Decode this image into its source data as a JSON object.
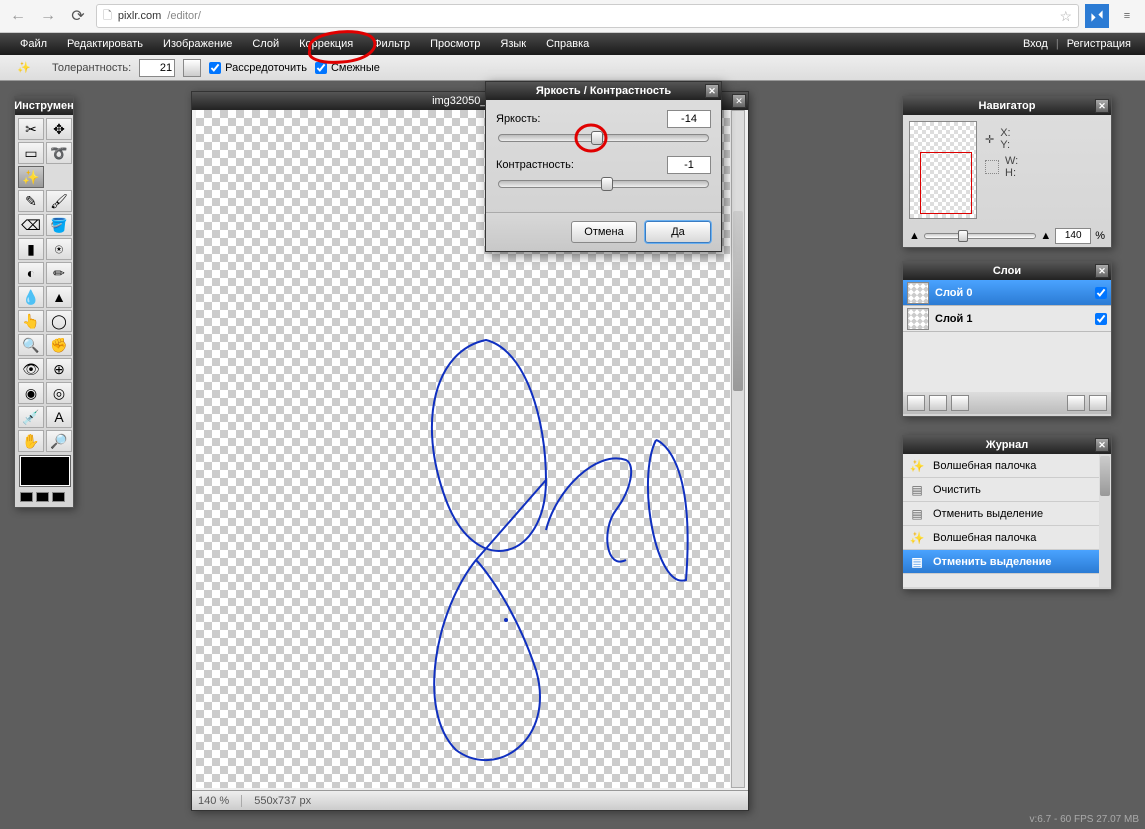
{
  "browser": {
    "url_host": "pixlr.com",
    "url_path": "/editor/"
  },
  "menubar": {
    "items": [
      "Файл",
      "Редактировать",
      "Изображение",
      "Слой",
      "Коррекция",
      "Фильтр",
      "Просмотр",
      "Язык",
      "Справка"
    ],
    "login": "Вход",
    "register": "Регистрация"
  },
  "options": {
    "tolerance_label": "Толерантность:",
    "tolerance_value": "21",
    "contiguous_label": "Рассредоточить",
    "contiguous_checked": true,
    "adjacent_label": "Смежные",
    "adjacent_checked": true
  },
  "tools_panel": {
    "title": "Инструмен"
  },
  "canvas": {
    "title": "img32050_auto",
    "zoom": "140 %",
    "dims": "550x737 px"
  },
  "dialog": {
    "title": "Яркость / Контрастность",
    "brightness_label": "Яркость:",
    "brightness_value": "-14",
    "contrast_label": "Контрастность:",
    "contrast_value": "-1",
    "cancel": "Отмена",
    "ok": "Да"
  },
  "navigator": {
    "title": "Навигатор",
    "x_label": "X:",
    "y_label": "Y:",
    "w_label": "W:",
    "h_label": "H:",
    "zoom_value": "140",
    "zoom_pct": "%"
  },
  "layers": {
    "title": "Слои",
    "items": [
      {
        "name": "Слой 0",
        "selected": true,
        "visible": true
      },
      {
        "name": "Слой 1",
        "selected": false,
        "visible": true
      }
    ]
  },
  "history": {
    "title": "Журнал",
    "items": [
      {
        "label": "Волшебная палочка",
        "selected": false
      },
      {
        "label": "Очистить",
        "selected": false
      },
      {
        "label": "Отменить выделение",
        "selected": false
      },
      {
        "label": "Волшебная палочка",
        "selected": false
      },
      {
        "label": "Отменить выделение",
        "selected": true
      }
    ]
  },
  "status": "v:6.7 - 60 FPS 27.07 MB"
}
